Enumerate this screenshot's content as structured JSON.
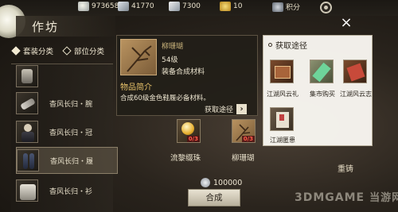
{
  "resources": [
    {
      "icon": "jade-icon",
      "value": "973658"
    },
    {
      "icon": "silver-icon",
      "value": "41770"
    },
    {
      "icon": "ingot-icon",
      "value": "7300"
    },
    {
      "icon": "gold-icon",
      "value": "10"
    },
    {
      "icon": "score-icon",
      "value": "积分"
    }
  ],
  "header": {
    "title": "作坊"
  },
  "filters": [
    {
      "label": "套装分类",
      "selected": true
    },
    {
      "label": "部位分类",
      "selected": false
    }
  ],
  "list": {
    "items": [
      {
        "label": "",
        "selected": false
      },
      {
        "label": "杳风长归・腕",
        "selected": false
      },
      {
        "label": "杳风长归・冠",
        "selected": false
      },
      {
        "label": "杳风长归・履",
        "selected": true
      },
      {
        "label": "杳风长归・衫",
        "selected": false
      }
    ]
  },
  "detail": {
    "name": "柳珊瑚",
    "level": "54级",
    "type": "装备合成材料",
    "section_title": "物品简介",
    "description": "合成60级金色鞋履必备材料。",
    "source_link": "获取途径",
    "chevron": "›"
  },
  "materials": [
    {
      "label": "流黎缀珠",
      "count": "0/3"
    },
    {
      "label": "柳珊瑚",
      "count": "0/3"
    }
  ],
  "cost": {
    "value": "100000"
  },
  "craft_button": "合成",
  "popup": {
    "title": "获取途径",
    "sources": [
      {
        "label": "江湖风云礼",
        "icon": "gift-box-icon"
      },
      {
        "label": "集市购买",
        "icon": "market-icon"
      },
      {
        "label": "江湖风云志",
        "icon": "journal-icon"
      },
      {
        "label": "江湖匿患",
        "icon": "bounty-icon"
      }
    ]
  },
  "close": "×",
  "reforge": "重铸",
  "watermark": {
    "brand": "3DMGAME",
    "cn": "当游网"
  },
  "colors": {
    "accent_gold": "#e8c26a",
    "warning_red": "#ff5a4a",
    "popup_bg": "#fcfaf4"
  }
}
